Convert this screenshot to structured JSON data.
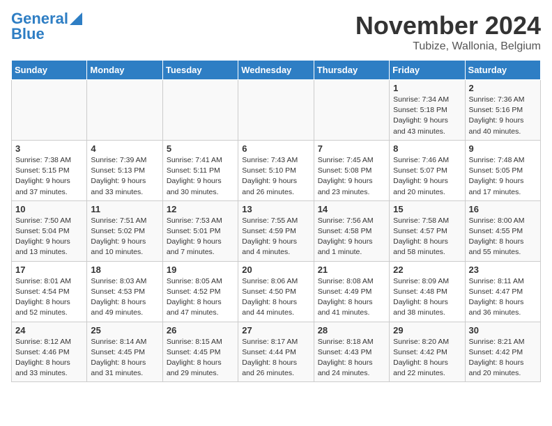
{
  "header": {
    "logo_general": "General",
    "logo_blue": "Blue",
    "month": "November 2024",
    "location": "Tubize, Wallonia, Belgium"
  },
  "days_of_week": [
    "Sunday",
    "Monday",
    "Tuesday",
    "Wednesday",
    "Thursday",
    "Friday",
    "Saturday"
  ],
  "weeks": [
    [
      {
        "day": "",
        "info": ""
      },
      {
        "day": "",
        "info": ""
      },
      {
        "day": "",
        "info": ""
      },
      {
        "day": "",
        "info": ""
      },
      {
        "day": "",
        "info": ""
      },
      {
        "day": "1",
        "info": "Sunrise: 7:34 AM\nSunset: 5:18 PM\nDaylight: 9 hours\nand 43 minutes."
      },
      {
        "day": "2",
        "info": "Sunrise: 7:36 AM\nSunset: 5:16 PM\nDaylight: 9 hours\nand 40 minutes."
      }
    ],
    [
      {
        "day": "3",
        "info": "Sunrise: 7:38 AM\nSunset: 5:15 PM\nDaylight: 9 hours\nand 37 minutes."
      },
      {
        "day": "4",
        "info": "Sunrise: 7:39 AM\nSunset: 5:13 PM\nDaylight: 9 hours\nand 33 minutes."
      },
      {
        "day": "5",
        "info": "Sunrise: 7:41 AM\nSunset: 5:11 PM\nDaylight: 9 hours\nand 30 minutes."
      },
      {
        "day": "6",
        "info": "Sunrise: 7:43 AM\nSunset: 5:10 PM\nDaylight: 9 hours\nand 26 minutes."
      },
      {
        "day": "7",
        "info": "Sunrise: 7:45 AM\nSunset: 5:08 PM\nDaylight: 9 hours\nand 23 minutes."
      },
      {
        "day": "8",
        "info": "Sunrise: 7:46 AM\nSunset: 5:07 PM\nDaylight: 9 hours\nand 20 minutes."
      },
      {
        "day": "9",
        "info": "Sunrise: 7:48 AM\nSunset: 5:05 PM\nDaylight: 9 hours\nand 17 minutes."
      }
    ],
    [
      {
        "day": "10",
        "info": "Sunrise: 7:50 AM\nSunset: 5:04 PM\nDaylight: 9 hours\nand 13 minutes."
      },
      {
        "day": "11",
        "info": "Sunrise: 7:51 AM\nSunset: 5:02 PM\nDaylight: 9 hours\nand 10 minutes."
      },
      {
        "day": "12",
        "info": "Sunrise: 7:53 AM\nSunset: 5:01 PM\nDaylight: 9 hours\nand 7 minutes."
      },
      {
        "day": "13",
        "info": "Sunrise: 7:55 AM\nSunset: 4:59 PM\nDaylight: 9 hours\nand 4 minutes."
      },
      {
        "day": "14",
        "info": "Sunrise: 7:56 AM\nSunset: 4:58 PM\nDaylight: 9 hours\nand 1 minute."
      },
      {
        "day": "15",
        "info": "Sunrise: 7:58 AM\nSunset: 4:57 PM\nDaylight: 8 hours\nand 58 minutes."
      },
      {
        "day": "16",
        "info": "Sunrise: 8:00 AM\nSunset: 4:55 PM\nDaylight: 8 hours\nand 55 minutes."
      }
    ],
    [
      {
        "day": "17",
        "info": "Sunrise: 8:01 AM\nSunset: 4:54 PM\nDaylight: 8 hours\nand 52 minutes."
      },
      {
        "day": "18",
        "info": "Sunrise: 8:03 AM\nSunset: 4:53 PM\nDaylight: 8 hours\nand 49 minutes."
      },
      {
        "day": "19",
        "info": "Sunrise: 8:05 AM\nSunset: 4:52 PM\nDaylight: 8 hours\nand 47 minutes."
      },
      {
        "day": "20",
        "info": "Sunrise: 8:06 AM\nSunset: 4:50 PM\nDaylight: 8 hours\nand 44 minutes."
      },
      {
        "day": "21",
        "info": "Sunrise: 8:08 AM\nSunset: 4:49 PM\nDaylight: 8 hours\nand 41 minutes."
      },
      {
        "day": "22",
        "info": "Sunrise: 8:09 AM\nSunset: 4:48 PM\nDaylight: 8 hours\nand 38 minutes."
      },
      {
        "day": "23",
        "info": "Sunrise: 8:11 AM\nSunset: 4:47 PM\nDaylight: 8 hours\nand 36 minutes."
      }
    ],
    [
      {
        "day": "24",
        "info": "Sunrise: 8:12 AM\nSunset: 4:46 PM\nDaylight: 8 hours\nand 33 minutes."
      },
      {
        "day": "25",
        "info": "Sunrise: 8:14 AM\nSunset: 4:45 PM\nDaylight: 8 hours\nand 31 minutes."
      },
      {
        "day": "26",
        "info": "Sunrise: 8:15 AM\nSunset: 4:45 PM\nDaylight: 8 hours\nand 29 minutes."
      },
      {
        "day": "27",
        "info": "Sunrise: 8:17 AM\nSunset: 4:44 PM\nDaylight: 8 hours\nand 26 minutes."
      },
      {
        "day": "28",
        "info": "Sunrise: 8:18 AM\nSunset: 4:43 PM\nDaylight: 8 hours\nand 24 minutes."
      },
      {
        "day": "29",
        "info": "Sunrise: 8:20 AM\nSunset: 4:42 PM\nDaylight: 8 hours\nand 22 minutes."
      },
      {
        "day": "30",
        "info": "Sunrise: 8:21 AM\nSunset: 4:42 PM\nDaylight: 8 hours\nand 20 minutes."
      }
    ]
  ]
}
